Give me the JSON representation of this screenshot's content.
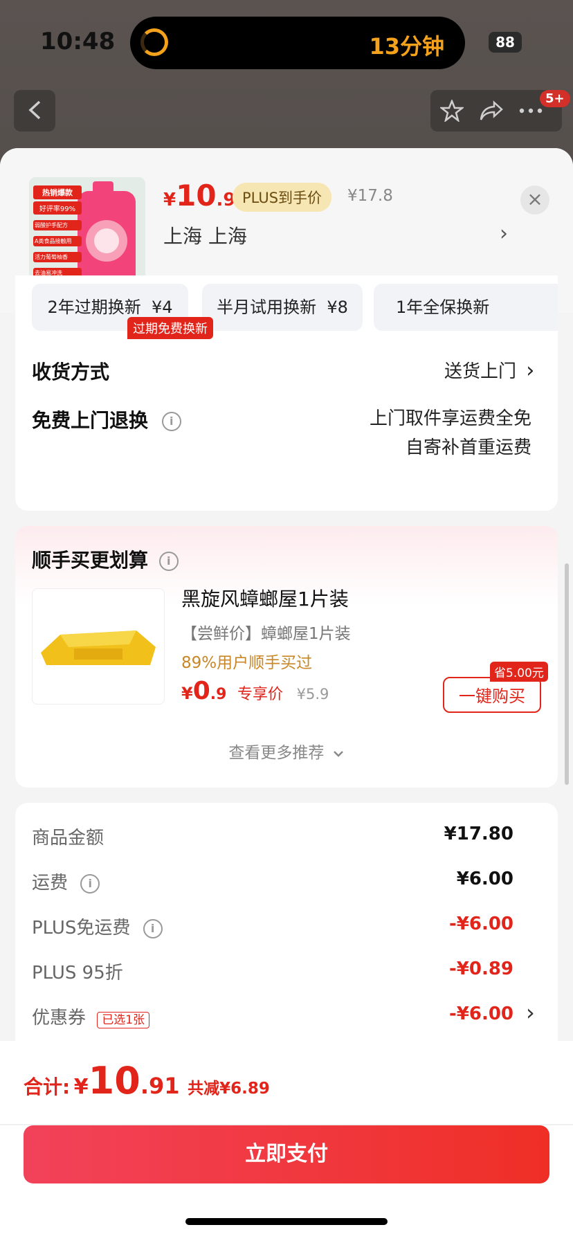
{
  "status_bar": {
    "time": "10:48",
    "activity": "13分钟",
    "battery": "88"
  },
  "background_app": {
    "badge_count": "5+"
  },
  "product": {
    "price_currency": "¥",
    "price_int": "10",
    "price_dec": ".91",
    "plus_tag": "PLUS到手价",
    "original_price": "¥17.8",
    "location": "上海  上海",
    "image_labels": [
      "热销爆款",
      "好评率99%",
      "弱酸护手配方",
      "A类食品接触用",
      "活力葡萄柚香",
      "去油易冲洗"
    ]
  },
  "service_options": {
    "items": [
      {
        "label": "2年过期换新",
        "price": "¥4"
      },
      {
        "label": "半月试用换新",
        "price": "¥8"
      },
      {
        "label": "1年全保换新"
      }
    ],
    "promo_tag": "过期免费换新"
  },
  "delivery": {
    "label": "收货方式",
    "value": "送货上门"
  },
  "returns": {
    "label": "免费上门退换",
    "line1": "上门取件享运费全免",
    "line2": "自寄补首重运费"
  },
  "recommend": {
    "title": "顺手买更划算",
    "item_title": "黑旋风蟑螂屋1片装",
    "item_sub": "【尝鲜价】蟑螂屋1片装",
    "item_stat": "89%用户顺手买过",
    "price_currency": "¥",
    "price_int": "0",
    "price_dec": ".9",
    "price_label": "专享价",
    "price_orig": "¥5.9",
    "save_tag": "省5.00元",
    "buy_label": "一键购买",
    "more_label": "查看更多推荐"
  },
  "summary": {
    "rows": [
      {
        "label": "商品金额",
        "value": "¥17.80"
      },
      {
        "label": "运费",
        "value": "¥6.00"
      },
      {
        "label": "PLUS免运费",
        "value": "-¥6.00"
      },
      {
        "label": "PLUS 95折",
        "value": "-¥0.89"
      },
      {
        "label": "优惠券",
        "value": "-¥6.00",
        "tag": "已选1张"
      }
    ]
  },
  "footer": {
    "total_label": "合计:",
    "total_currency": "¥",
    "total_int": "10",
    "total_dec": ".91",
    "discount": "共减¥6.89",
    "pay_label": "立即支付"
  },
  "colors": {
    "accent": "#e1251b",
    "plus_gold": "#f6e6b4",
    "island_orange": "#f4a21c"
  }
}
